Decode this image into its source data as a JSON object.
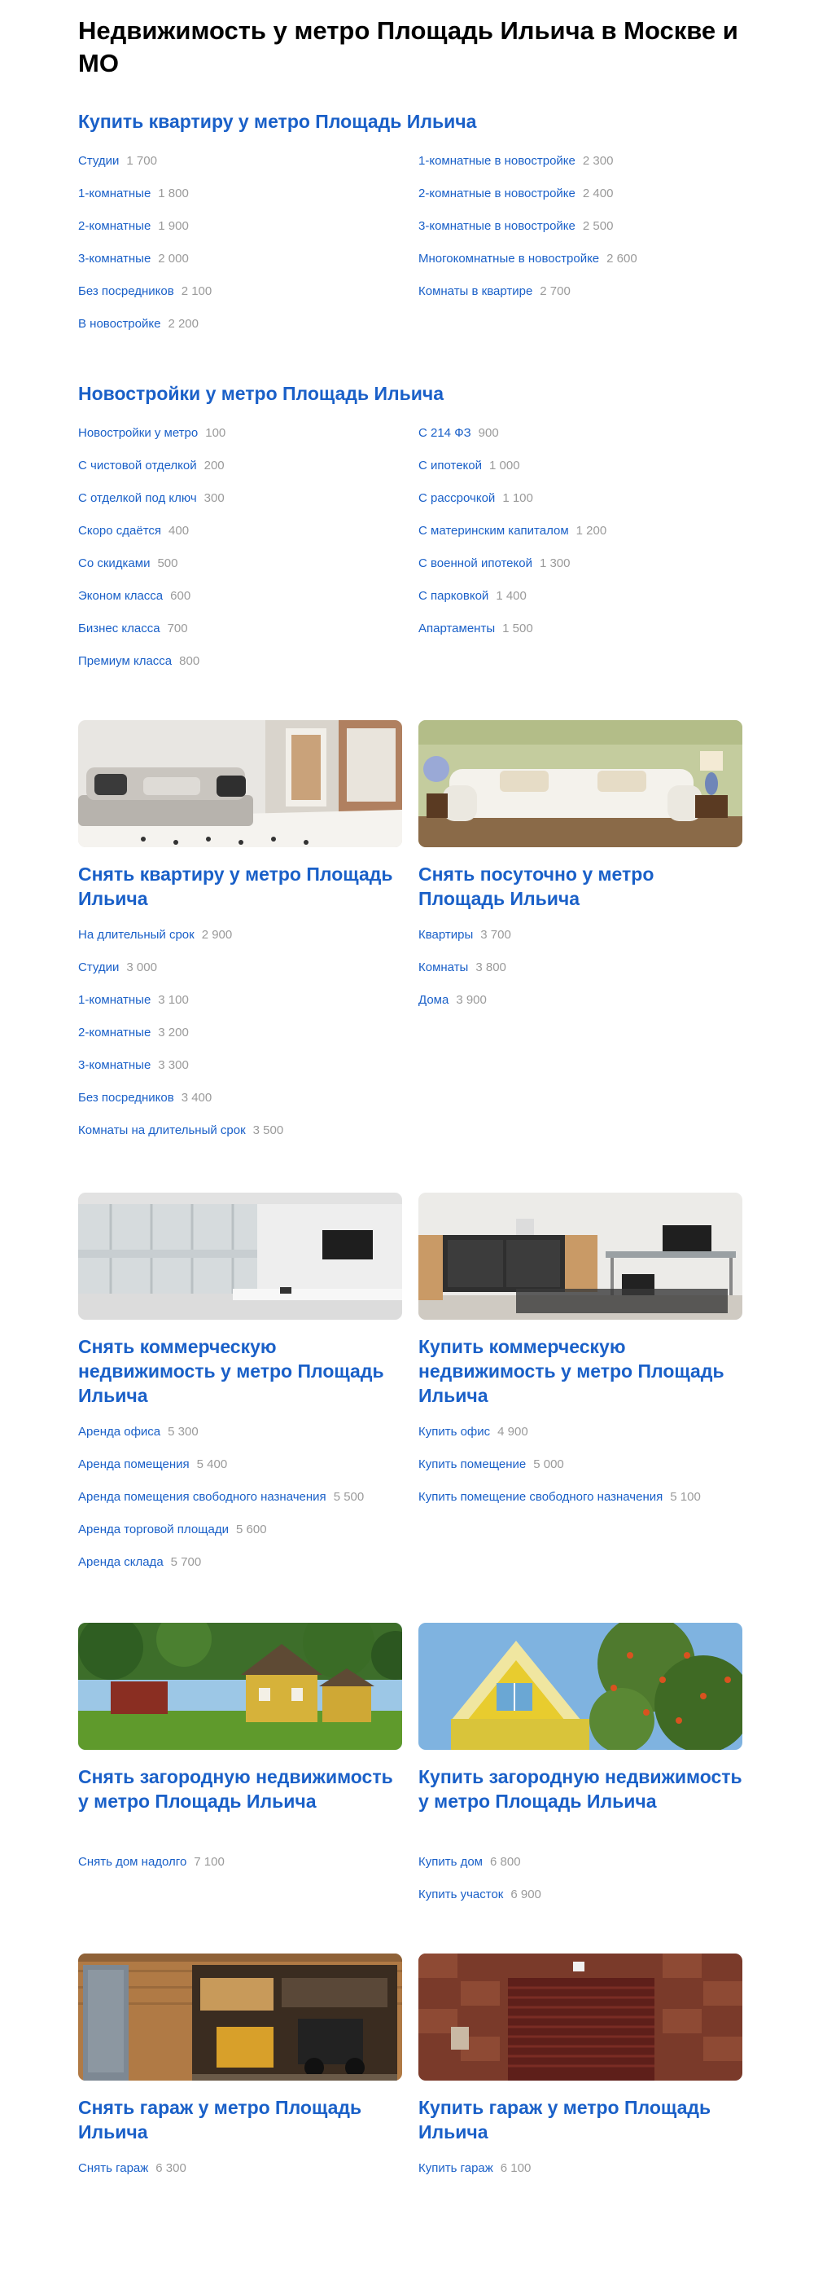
{
  "page": {
    "title": "Недвижимость у метро Площадь Ильича в Москве и МО"
  },
  "buy_flat": {
    "title": "Купить квартиру у метро Площадь Ильича",
    "left": [
      {
        "label": "Студии",
        "count": "1 700"
      },
      {
        "label": "1-комнатные",
        "count": "1 800"
      },
      {
        "label": "2-комнатные",
        "count": "1 900"
      },
      {
        "label": "3-комнатные",
        "count": "2 000"
      },
      {
        "label": "Без посредников",
        "count": "2 100"
      },
      {
        "label": "В новостройке",
        "count": "2 200"
      }
    ],
    "right": [
      {
        "label": "1-комнатные в новостройке",
        "count": "2 300"
      },
      {
        "label": "2-комнатные в новостройке",
        "count": "2 400"
      },
      {
        "label": "3-комнатные в новостройке",
        "count": "2 500"
      },
      {
        "label": "Многокомнатные в новостройке",
        "count": "2 600"
      },
      {
        "label": "Комнаты в квартире",
        "count": "2 700"
      }
    ]
  },
  "new_buildings": {
    "title": "Новостройки у метро Площадь Ильича",
    "left": [
      {
        "label": "Новостройки у метро",
        "count": "100"
      },
      {
        "label": "С чистовой отделкой",
        "count": "200"
      },
      {
        "label": "С отделкой под ключ",
        "count": "300"
      },
      {
        "label": "Скоро сдаётся",
        "count": "400"
      },
      {
        "label": "Со скидками",
        "count": "500"
      },
      {
        "label": "Эконом класса",
        "count": "600"
      },
      {
        "label": "Бизнес класса",
        "count": "700"
      },
      {
        "label": "Премиум класса",
        "count": "800"
      }
    ],
    "right": [
      {
        "label": "С 214 ФЗ",
        "count": "900"
      },
      {
        "label": "С ипотекой",
        "count": "1 000"
      },
      {
        "label": "С рассрочкой",
        "count": "1 100"
      },
      {
        "label": "С материнским капиталом",
        "count": "1 200"
      },
      {
        "label": "С военной ипотекой",
        "count": "1 300"
      },
      {
        "label": "С парковкой",
        "count": "1 400"
      },
      {
        "label": "Апартаменты",
        "count": "1 500"
      }
    ]
  },
  "rent_flat": {
    "title": "Снять квартиру у метро Площадь Ильича",
    "items": [
      {
        "label": "На длительный срок",
        "count": "2 900"
      },
      {
        "label": "Студии",
        "count": "3 000"
      },
      {
        "label": "1-комнатные",
        "count": "3 100"
      },
      {
        "label": "2-комнатные",
        "count": "3 200"
      },
      {
        "label": "3-комнатные",
        "count": "3 300"
      },
      {
        "label": "Без посредников",
        "count": "3 400"
      },
      {
        "label": "Комнаты на длительный срок",
        "count": "3 500"
      }
    ]
  },
  "rent_daily": {
    "title": "Снять посуточно у метро Площадь Ильича",
    "items": [
      {
        "label": "Квартиры",
        "count": "3 700"
      },
      {
        "label": "Комнаты",
        "count": "3 800"
      },
      {
        "label": "Дома",
        "count": "3 900"
      }
    ]
  },
  "rent_commercial": {
    "title": "Снять коммерческую недвижимость у метро Площадь Ильича",
    "items": [
      {
        "label": "Аренда офиса",
        "count": "5 300"
      },
      {
        "label": "Аренда помещения",
        "count": "5 400"
      },
      {
        "label": "Аренда помещения свободного назначения",
        "count": "5 500"
      },
      {
        "label": "Аренда торговой площади",
        "count": "5 600"
      },
      {
        "label": "Аренда склада",
        "count": "5 700"
      }
    ]
  },
  "buy_commercial": {
    "title": "Купить коммерческую недвижимость у метро Площадь Ильича",
    "items": [
      {
        "label": "Купить офис",
        "count": "4 900"
      },
      {
        "label": "Купить помещение",
        "count": "5 000"
      },
      {
        "label": "Купить помещение свободного назначения",
        "count": "5 100"
      }
    ]
  },
  "rent_country": {
    "title": "Снять загородную недвижимость у метро Площадь Ильича",
    "items": [
      {
        "label": "Снять дом надолго",
        "count": "7 100"
      }
    ]
  },
  "buy_country": {
    "title": "Купить загородную недвижимость у метро Площадь Ильича",
    "items": [
      {
        "label": "Купить дом",
        "count": "6 800"
      },
      {
        "label": "Купить участок",
        "count": "6 900"
      }
    ]
  },
  "rent_garage": {
    "title": "Снять гараж у метро Площадь Ильича",
    "items": [
      {
        "label": "Снять гараж",
        "count": "6 300"
      }
    ]
  },
  "buy_garage": {
    "title": "Купить гараж у метро Площадь Ильича",
    "items": [
      {
        "label": "Купить гараж",
        "count": "6 100"
      }
    ]
  },
  "colors": {
    "link": "#1a60c8",
    "count": "#9a9a9a",
    "title": "#000000"
  }
}
